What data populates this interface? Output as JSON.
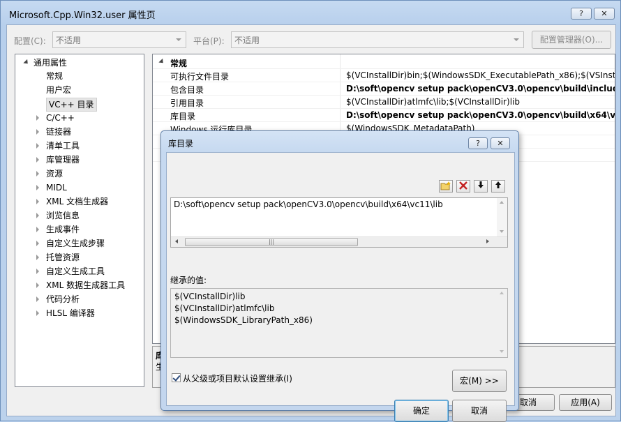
{
  "window": {
    "title": "Microsoft.Cpp.Win32.user 属性页",
    "help_button": "?",
    "close_button": "✕"
  },
  "toolbar": {
    "config_label": "配置(C):",
    "config_value": "不适用",
    "platform_label": "平台(P):",
    "platform_value": "不适用",
    "config_manager_button": "配置管理器(O)..."
  },
  "tree": {
    "root": "通用属性",
    "items": [
      {
        "label": "常规",
        "expandable": false
      },
      {
        "label": "用户宏",
        "expandable": false
      },
      {
        "label": "VC++ 目录",
        "expandable": false,
        "selected": true
      },
      {
        "label": "C/C++",
        "expandable": true
      },
      {
        "label": "链接器",
        "expandable": true
      },
      {
        "label": "清单工具",
        "expandable": true
      },
      {
        "label": "库管理器",
        "expandable": true
      },
      {
        "label": "资源",
        "expandable": true
      },
      {
        "label": "MIDL",
        "expandable": true
      },
      {
        "label": "XML 文档生成器",
        "expandable": true
      },
      {
        "label": "浏览信息",
        "expandable": true
      },
      {
        "label": "生成事件",
        "expandable": true
      },
      {
        "label": "自定义生成步骤",
        "expandable": true
      },
      {
        "label": "托管资源",
        "expandable": true
      },
      {
        "label": "自定义生成工具",
        "expandable": true
      },
      {
        "label": "XML 数据生成器工具",
        "expandable": true
      },
      {
        "label": "代码分析",
        "expandable": true
      },
      {
        "label": "HLSL 编译器",
        "expandable": true
      }
    ]
  },
  "grid": {
    "category": "常规",
    "rows": [
      {
        "name": "可执行文件目录",
        "value": "$(VCInstallDir)bin;$(WindowsSDK_ExecutablePath_x86);$(VSInstallI",
        "bold": false
      },
      {
        "name": "包含目录",
        "value": "D:\\soft\\opencv setup pack\\openCV3.0\\opencv\\build\\include;",
        "bold": true
      },
      {
        "name": "引用目录",
        "value": "$(VCInstallDir)atlmfc\\lib;$(VCInstallDir)lib",
        "bold": false
      },
      {
        "name": "库目录",
        "value": "D:\\soft\\opencv setup pack\\openCV3.0\\opencv\\build\\x64\\vc1",
        "bold": true
      },
      {
        "name": "Windows 运行库目录",
        "value": "$(WindowsSDK_MetadataPath)",
        "bold": false
      },
      {
        "name": "",
        "value": "atlmfc\\src\\mfcm;$(VC",
        "bold": false
      },
      {
        "name": "",
        "value": "include;$(WindowsSDK",
        "bold": false
      }
    ]
  },
  "description": {
    "title": "库",
    "text": "生"
  },
  "footer": {
    "cancel_button": "取消",
    "apply_button": "应用(A)"
  },
  "dialog": {
    "title": "库目录",
    "help_button": "?",
    "close_button": "✕",
    "entries": [
      "D:\\soft\\opencv setup pack\\openCV3.0\\opencv\\build\\x64\\vc11\\lib"
    ],
    "inherited_label": "继承的值:",
    "inherited_values": [
      "$(VCInstallDir)lib",
      "$(VCInstallDir)atlmfc\\lib",
      "$(WindowsSDK_LibraryPath_x86)"
    ],
    "inherit_checkbox_label": "从父级或项目默认设置继承(I)",
    "inherit_checked": true,
    "macro_button": "宏(M) >>",
    "ok_button": "确定",
    "cancel_button": "取消"
  }
}
